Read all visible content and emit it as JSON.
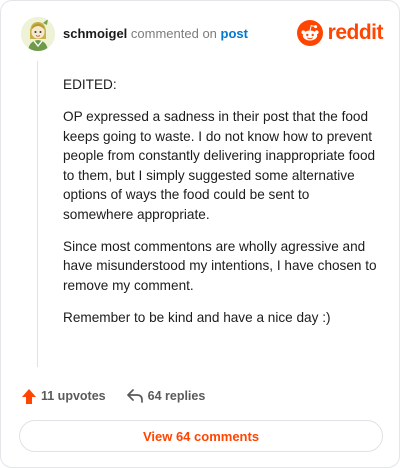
{
  "header": {
    "username": "schmoigel",
    "action_text": "commented on",
    "target_link": "post",
    "brand_name": "reddit"
  },
  "comment": {
    "paragraphs": [
      "EDITED:",
      "OP expressed a sadness in their post that the food keeps going to waste. I do not know how to prevent people from constantly delivering inappropriate food to them, but I simply suggested some alternative options of ways the food could be sent to somewhere appropriate.",
      "Since most commentons are wholly agressive and have misunderstood my intentions, I have chosen to remove my comment.",
      "Remember to be kind and have a nice day :)"
    ]
  },
  "actions": {
    "upvotes_label": "11 upvotes",
    "replies_label": "64 replies"
  },
  "footer": {
    "view_comments_label": "View 64 comments"
  },
  "colors": {
    "brand": "#ff4500",
    "link": "#0079d3",
    "text": "#1c1c1c",
    "muted": "#7c7c7c"
  },
  "icons": [
    "avatar-image",
    "reddit-logo-icon",
    "upvote-arrow-icon",
    "reply-arrow-icon"
  ]
}
